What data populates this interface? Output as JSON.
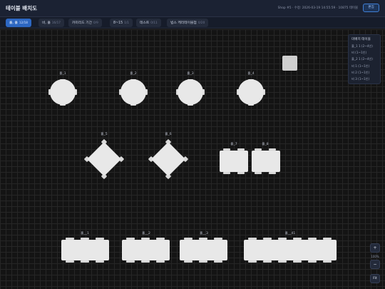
{
  "header": {
    "title": "테이블 배치도",
    "meta": "Shop #5 · 수정: 2026-03-19 14:55:59 · 10875 테이블",
    "edit_label": "편집"
  },
  "tabs": [
    {
      "label": "홀, 홀",
      "count": "12/18",
      "active": true
    },
    {
      "label": "비, 홀",
      "count": "16/17",
      "active": false
    },
    {
      "label": "카미리드 기간",
      "count": "0/9",
      "active": false
    },
    {
      "label": "8~15",
      "count": "1/1",
      "active": false
    },
    {
      "label": "테스트",
      "count": "0/11",
      "active": false
    },
    {
      "label": "빕스 케리테이블점",
      "count": "0/20",
      "active": false
    }
  ],
  "tables": [
    {
      "label": "홀_1"
    },
    {
      "label": "홀_2"
    },
    {
      "label": "홀_3"
    },
    {
      "label": "홀_4"
    },
    {
      "label": "홀_5"
    },
    {
      "label": "홀_6"
    },
    {
      "label": "홀_7"
    },
    {
      "label": "홀_8"
    },
    {
      "label": "홀__1"
    },
    {
      "label": "홀__2"
    },
    {
      "label": "홀__3"
    },
    {
      "label": "홀__41"
    }
  ],
  "legend": {
    "title": "미배치 테이블",
    "items": [
      "홀_1 1 (2~4인)",
      "비 (1~1인)",
      "홀_2 1 (2~4인)",
      "비 1 (1~1인)",
      "비 2 (1~1인)",
      "비 3 (1~1인)"
    ]
  },
  "zoom": {
    "in_label": "+",
    "level": "100%",
    "out_label": "−",
    "fit_label": "Fit"
  },
  "colors": {
    "accent": "#2d67c2",
    "table": "#e8e8e8",
    "canvas": "#141414"
  }
}
